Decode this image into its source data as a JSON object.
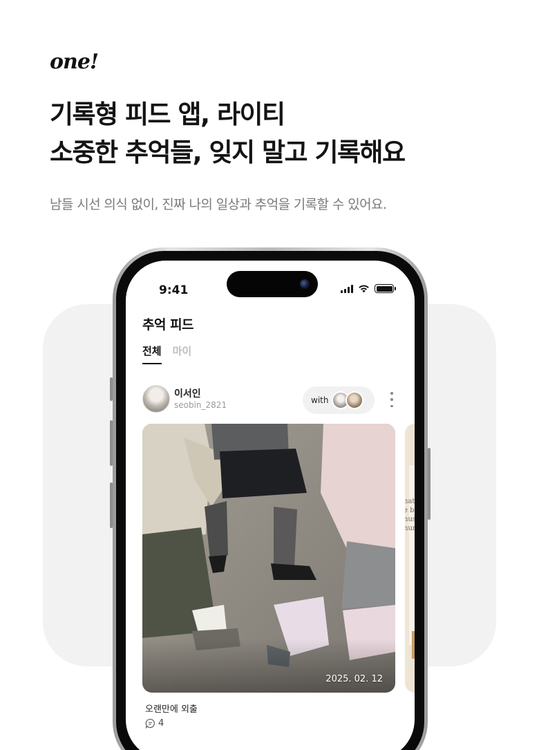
{
  "brand": {
    "logo": "one!"
  },
  "promo": {
    "headline_line1": "기록형 피드 앱, 라이티",
    "headline_line2": "소중한 추억들, 잊지 말고 기록해요",
    "subheadline": "남들 시선 의식 없이, 진짜 나의 일상과 추억을 기록할 수 있어요."
  },
  "status_bar": {
    "time": "9:41",
    "icons": [
      "signal-icon",
      "wifi-icon",
      "battery-icon"
    ]
  },
  "screen": {
    "title": "추억 피드",
    "tabs": [
      {
        "label": "전체",
        "active": true
      },
      {
        "label": "마이",
        "active": false
      }
    ]
  },
  "post": {
    "user_name": "이서인",
    "user_handle": "seobin_2821",
    "with_label": "with",
    "photo_date": "2025. 02. 12",
    "caption": "오랜만에 외출",
    "comment_count": "4",
    "next_photo_snippet": [
      "nate",
      "e bu",
      "nus",
      "num"
    ]
  },
  "colors": {
    "background_card": "#f2f2f2",
    "text_primary": "#111111",
    "text_secondary": "#7a7a7a",
    "tab_inactive": "#bdbdbd"
  }
}
